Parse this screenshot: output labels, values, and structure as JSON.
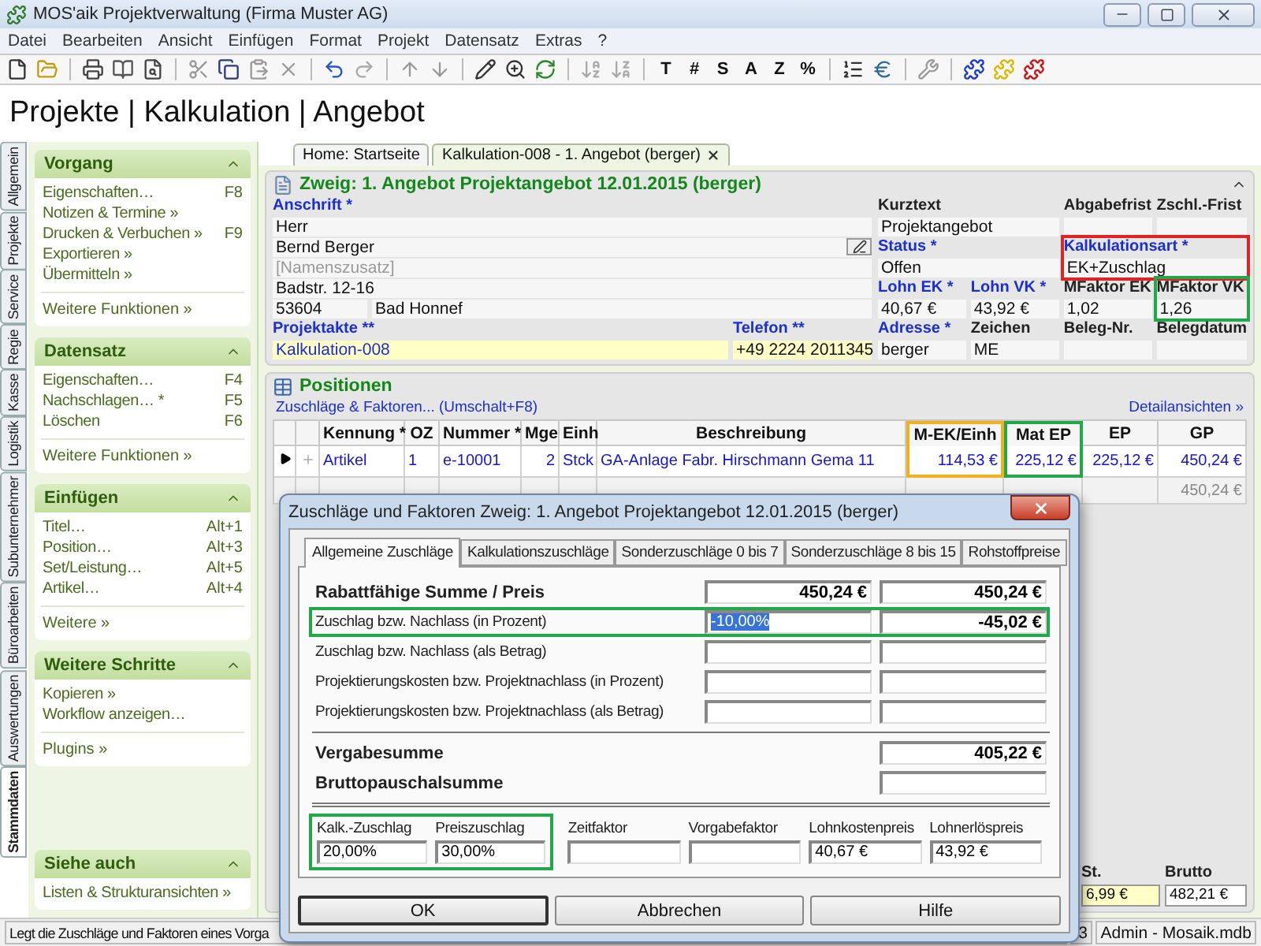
{
  "window": {
    "title": "MOS'aik Projektverwaltung (Firma Muster AG)"
  },
  "menu": [
    "Datei",
    "Bearbeiten",
    "Ansicht",
    "Einfügen",
    "Format",
    "Projekt",
    "Datensatz",
    "Extras",
    "?"
  ],
  "toolbar_text_buttons": [
    "T",
    "#",
    "S",
    "A",
    "Z",
    "%"
  ],
  "heading": "Projekte | Kalkulation | Angebot",
  "side_tabs": [
    {
      "label": "Allgemein",
      "selected": false
    },
    {
      "label": "Projekte",
      "selected": false
    },
    {
      "label": "Service",
      "selected": false
    },
    {
      "label": "Regie",
      "selected": false
    },
    {
      "label": "Kasse",
      "selected": false
    },
    {
      "label": "Logistik",
      "selected": false
    },
    {
      "label": "Subunternehmer",
      "selected": false
    },
    {
      "label": "Büroarbeiten",
      "selected": false
    },
    {
      "label": "Auswertungen",
      "selected": false
    },
    {
      "label": "Stammdaten",
      "selected": true
    }
  ],
  "sidebar": [
    {
      "title": "Vorgang",
      "expanded": true,
      "items": [
        {
          "label": "Eigenschaften…",
          "shortcut": "F8"
        },
        {
          "label": "Notizen & Termine »"
        },
        {
          "label": "Drucken & Verbuchen »",
          "shortcut": "F9"
        },
        {
          "label": "Exportieren »"
        },
        {
          "label": "Übermitteln »"
        }
      ],
      "footer": "Weitere Funktionen »"
    },
    {
      "title": "Datensatz",
      "expanded": true,
      "items": [
        {
          "label": "Eigenschaften…",
          "shortcut": "F4"
        },
        {
          "label": "Nachschlagen… *",
          "shortcut": "F5"
        },
        {
          "label": "Löschen",
          "shortcut": "F6"
        }
      ],
      "footer": "Weitere Funktionen »"
    },
    {
      "title": "Einfügen",
      "expanded": true,
      "items": [
        {
          "label": "Titel…",
          "shortcut": "Alt+1"
        },
        {
          "label": "Position…",
          "shortcut": "Alt+3"
        },
        {
          "label": "Set/Leistung…",
          "shortcut": "Alt+5"
        },
        {
          "label": "Artikel…",
          "shortcut": "Alt+4"
        }
      ],
      "footer": "Weitere »"
    },
    {
      "title": "Weitere Schritte",
      "expanded": true,
      "items": [
        {
          "label": "Kopieren »"
        },
        {
          "label": "Workflow anzeigen…"
        }
      ],
      "footer": "Plugins »"
    },
    {
      "title": "Siehe auch",
      "expanded": true,
      "items": [
        {
          "label": "Listen & Strukturansichten »"
        }
      ]
    }
  ],
  "doc_tabs": [
    {
      "label": "Home: Startseite",
      "selected": false,
      "closable": false
    },
    {
      "label": "Kalkulation-008 - 1. Angebot (berger)",
      "selected": true,
      "closable": true
    }
  ],
  "branch": {
    "title": "Zweig: 1. Angebot Projektangebot 12.01.2015 (berger)",
    "expanded": true,
    "address_label": "Anschrift *",
    "address_lines": [
      {
        "value": "Herr"
      },
      {
        "value": "Bernd Berger",
        "signature_button": true
      },
      {
        "placeholder": "[Namenszusatz]"
      },
      {
        "value": "Badstr. 12-16"
      }
    ],
    "zip": "53604",
    "city": "Bad Honnef",
    "project_file": {
      "label": "Projektakte **",
      "value": "Kalkulation-008",
      "link": true,
      "highlighted": true
    },
    "phone": {
      "label": "Telefon **",
      "value": "+49 2224 2011345",
      "link": true,
      "highlighted": true
    },
    "fields": [
      {
        "label": "Kurztext",
        "value": "Projektangebot",
        "link": false
      },
      {
        "label": "Abgabefrist",
        "link": false
      },
      {
        "label": "Zschl.-Frist",
        "link": false
      },
      {
        "label": "Status *",
        "value": "Offen",
        "link": true
      },
      {
        "label": "Kalkulationsart *",
        "value": "EK+Zuschlag",
        "link": true,
        "color": "#e02424"
      },
      {
        "label": "Lohn EK *",
        "value": "40,67 €",
        "link": true
      },
      {
        "label": "Lohn VK *",
        "value": "43,92 €",
        "link": true
      },
      {
        "label": "MFaktor EK",
        "value": "1,02",
        "link": false
      },
      {
        "label": "MFaktor VK",
        "value": "1,26",
        "link": false,
        "color": "#22a84a"
      },
      {
        "label": "Adresse *",
        "value": "berger",
        "link": true
      },
      {
        "label": "Zeichen",
        "value": "ME",
        "link": false
      },
      {
        "label": "Beleg-Nr.",
        "link": false
      },
      {
        "label": "Belegdatum",
        "link": false
      }
    ]
  },
  "positions": {
    "title": "Positionen",
    "action_link": "Zuschläge & Faktoren... (Umschalt+F8)",
    "details_link": "Detailansichten »",
    "columns": [
      {
        "label": "Kennung *"
      },
      {
        "label": "OZ"
      },
      {
        "label": "Nummer *"
      },
      {
        "label": "Mge"
      },
      {
        "label": "Einh"
      },
      {
        "label": "Beschreibung"
      },
      {
        "label": "M-EK/Einh",
        "color": "#f0b020"
      },
      {
        "label": "Mat EP",
        "color": "#22a84a"
      },
      {
        "label": "EP"
      },
      {
        "label": "GP"
      }
    ],
    "rows": [
      {
        "kind": "item",
        "current": true,
        "cells": [
          "Artikel",
          "1",
          "e-10001",
          "2",
          "Stck",
          "GA-Anlage Fabr. Hirschmann Gema 11",
          "114,53 €",
          "225,12 €",
          "225,12 €",
          "450,24 €"
        ]
      },
      {
        "kind": "subtotal",
        "total": "450,24 €"
      }
    ],
    "totals": [
      {
        "label": "St.",
        "value": "6,99 €",
        "highlighted": true
      },
      {
        "label": "Brutto",
        "value": "482,21 €",
        "highlighted": false
      }
    ]
  },
  "dialog": {
    "title": "Zuschläge und Faktoren Zweig: 1. Angebot Projektangebot 12.01.2015 (berger)",
    "tabs": [
      {
        "label": "Allgemeine Zuschläge",
        "selected": true
      },
      {
        "label": "Kalkulationszuschläge",
        "selected": false
      },
      {
        "label": "Sonderzuschläge 0 bis 7",
        "selected": false
      },
      {
        "label": "Sonderzuschläge 8 bis 15",
        "selected": false
      },
      {
        "label": "Rohstoffpreise",
        "selected": false
      }
    ],
    "rows": [
      {
        "kind": "header",
        "label": "Rabattfähige Summe / Preis",
        "input": "450,24 €",
        "result": "450,24 €"
      },
      {
        "kind": "input",
        "label": "Zuschlag bzw. Nachlass (in Prozent)",
        "input": "-10,00%",
        "input_selected": true,
        "result": "-45,02 €",
        "color": "#22a84a"
      },
      {
        "kind": "input",
        "label": "Zuschlag bzw. Nachlass (als Betrag)"
      },
      {
        "kind": "input",
        "label": "Projektierungskosten bzw. Projektnachlass (in Prozent)"
      },
      {
        "kind": "input",
        "label": "Projektierungskosten bzw. Projektnachlass (als Betrag)"
      },
      {
        "kind": "total",
        "label": "Vergabesumme",
        "result": "405,22 €"
      },
      {
        "kind": "total",
        "label": "Bruttopauschalsumme"
      }
    ],
    "factor_groups": [
      {
        "color": "#22a84a",
        "items": [
          {
            "label": "Kalk.-Zuschlag",
            "value": "20,00%"
          },
          {
            "label": "Preiszuschlag",
            "value": "30,00%"
          }
        ]
      },
      {
        "items": [
          {
            "label": "Zeitfaktor"
          },
          {
            "label": "Vorgabefaktor"
          },
          {
            "label": "Lohnkostenpreis",
            "value": "40,67 €"
          },
          {
            "label": "Lohnerlöspreis",
            "value": "43,92 €"
          }
        ]
      }
    ],
    "buttons": [
      {
        "label": "OK",
        "default": true
      },
      {
        "label": "Abbrechen",
        "default": false
      },
      {
        "label": "Hilfe",
        "default": false
      }
    ]
  },
  "status_bar": [
    "Legt die Zuschläge und Faktoren eines Vorga",
    "3",
    "Admin - Mosaik.mdb"
  ]
}
